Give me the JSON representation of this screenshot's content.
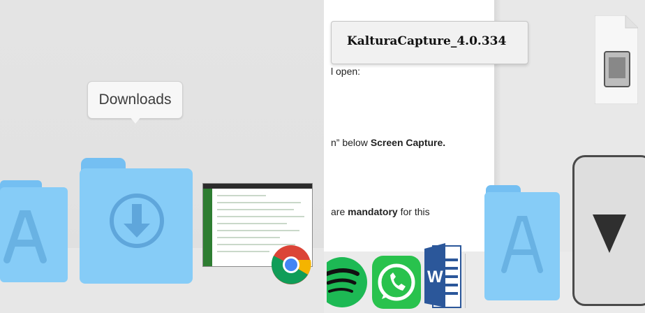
{
  "left_panel": {
    "tooltip_label": "Downloads",
    "dock_items": [
      "applications-folder-icon",
      "downloads-folder-icon",
      "screenshot-thumbnail",
      "chrome-icon"
    ]
  },
  "right_panel": {
    "filename_label": "KalturaCapture_4.0.334",
    "doc_lines": [
      {
        "pre": "l open:",
        "bold": "",
        "post": ""
      },
      {
        "pre": "n” below ",
        "bold": "Screen Capture.",
        "post": ""
      },
      {
        "pre": "are ",
        "bold": "mandatory",
        "post": " for this"
      }
    ],
    "dock_apps": [
      "spotify-icon",
      "whatsapp-icon",
      "word-icon",
      "applications-folder-icon",
      "downloads-stack-icon"
    ]
  },
  "colors": {
    "folder_light": "#86ccf7",
    "folder_tab": "#74bff2",
    "folder_glyph": "#63a9dd"
  }
}
